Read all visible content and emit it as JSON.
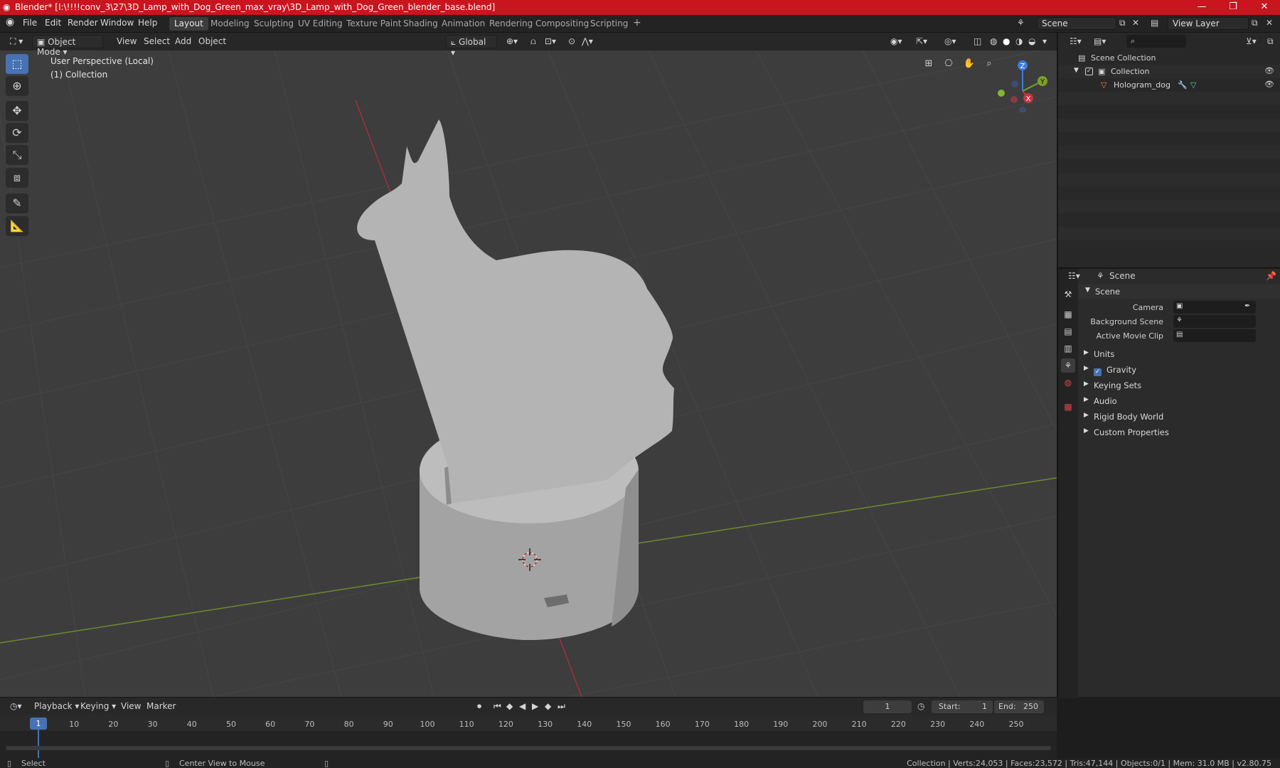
{
  "titlebar": {
    "title": "Blender* [I:\\!!!!conv_3\\27\\3D_Lamp_with_Dog_Green_max_vray\\3D_Lamp_with_Dog_Green_blender_base.blend]",
    "minimize": "—",
    "maximize": "❐",
    "close": "✕"
  },
  "menubar": {
    "items": [
      "File",
      "Edit",
      "Render",
      "Window",
      "Help"
    ],
    "workspaces": [
      "Layout",
      "Modeling",
      "Sculpting",
      "UV Editing",
      "Texture Paint",
      "Shading",
      "Animation",
      "Rendering",
      "Compositing",
      "Scripting"
    ],
    "add_workspace": "+",
    "scene_label": "Scene",
    "view_layer_label": "View Layer"
  },
  "viewport": {
    "mode": "Object Mode",
    "menus": [
      "View",
      "Select",
      "Add",
      "Object"
    ],
    "orientation": "Global",
    "overlay_title": "User Perspective (Local)",
    "overlay_collection": "(1) Collection",
    "gizmo": {
      "z": "Z",
      "y": "Y",
      "x": "X"
    },
    "colors": {
      "bg": "#3d3d3d",
      "grid": "#4a4a4a",
      "x_axis": "#b8353f",
      "y_axis": "#7aa02c",
      "model": "#b9b9b9"
    }
  },
  "outliner": {
    "root": "Scene Collection",
    "collection": "Collection",
    "object": "Hologram_dog"
  },
  "properties": {
    "header": "Scene",
    "panel": "Scene",
    "fields": {
      "camera": "Camera",
      "background_scene": "Background Scene",
      "active_movie_clip": "Active Movie Clip"
    },
    "sections": [
      "Units",
      "Gravity",
      "Keying Sets",
      "Audio",
      "Rigid Body World",
      "Custom Properties"
    ],
    "gravity_checked": true
  },
  "timeline": {
    "menus": [
      "Playback",
      "Keying",
      "View",
      "Marker"
    ],
    "current_frame": "1",
    "start_label": "Start:",
    "start": "1",
    "end_label": "End:",
    "end": "250",
    "ticks": [
      "1",
      "10",
      "20",
      "30",
      "40",
      "50",
      "60",
      "70",
      "80",
      "90",
      "100",
      "110",
      "120",
      "130",
      "140",
      "150",
      "160",
      "170",
      "180",
      "190",
      "200",
      "210",
      "220",
      "230",
      "240",
      "250"
    ]
  },
  "statusbar": {
    "select": "Select",
    "center": "Center View to Mouse",
    "stats": "Collection | Verts:24,053 | Faces:23,572 | Tris:47,144 | Objects:0/1 | Mem: 31.0 MB | v2.80.75"
  }
}
